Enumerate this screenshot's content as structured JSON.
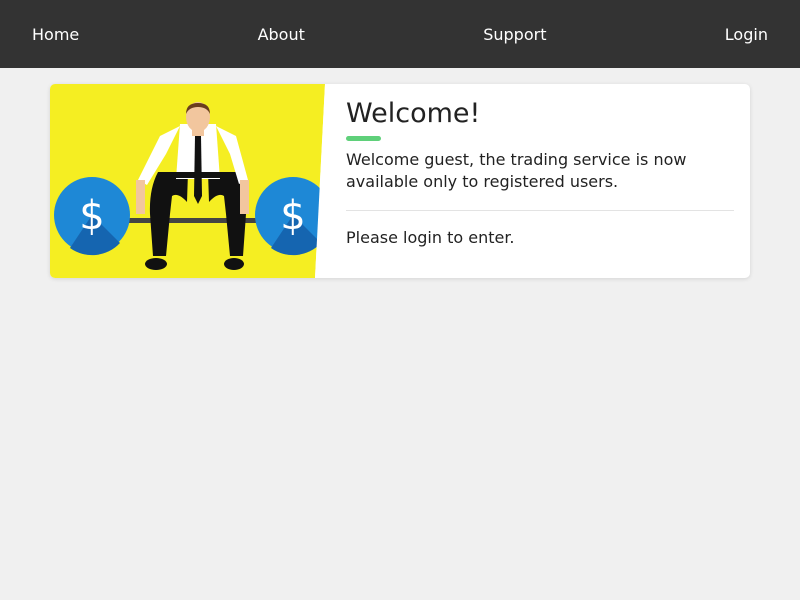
{
  "nav": {
    "items": [
      {
        "label": "Home"
      },
      {
        "label": "About"
      },
      {
        "label": "Support"
      },
      {
        "label": "Login"
      }
    ]
  },
  "card": {
    "title": "Welcome!",
    "message": "Welcome guest, the trading service is now available only to registered users.",
    "login_prompt": "Please login to enter.",
    "accent_color": "#5fd07a",
    "illustration": {
      "name": "weightlifter-with-dollar-coins",
      "background_color": "#f5ee22",
      "coin_color": "#1e88d6"
    }
  }
}
